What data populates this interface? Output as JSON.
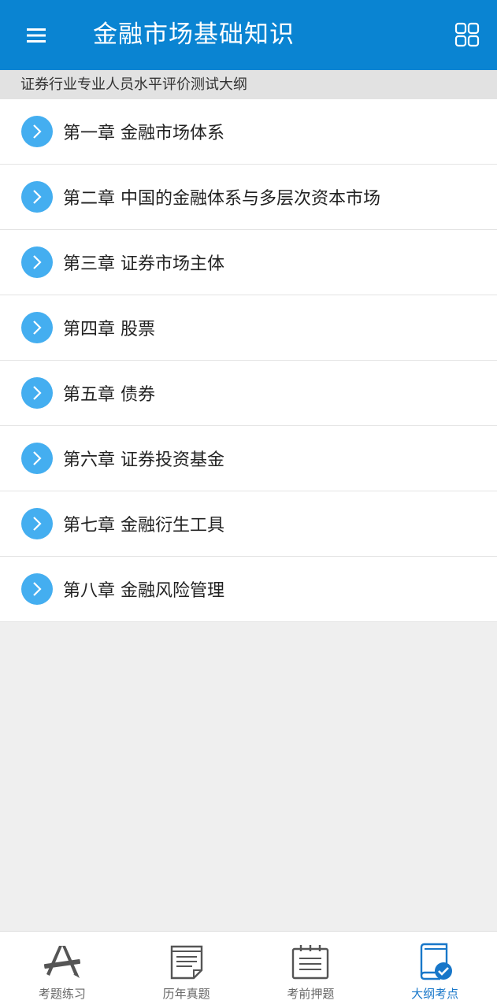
{
  "header": {
    "title": "金融市场基础知识",
    "menu_icon": "hamburger-icon",
    "grid_icon": "grid-icon"
  },
  "subheader": {
    "text": "证券行业专业人员水平评价测试大纲"
  },
  "chapters": [
    {
      "label": "第一章 金融市场体系"
    },
    {
      "label": "第二章 中国的金融体系与多层次资本市场"
    },
    {
      "label": "第三章 证券市场主体"
    },
    {
      "label": "第四章 股票"
    },
    {
      "label": "第五章 债券"
    },
    {
      "label": "第六章 证券投资基金"
    },
    {
      "label": "第七章 金融衍生工具"
    },
    {
      "label": "第八章 金融风险管理"
    }
  ],
  "tabs": [
    {
      "label": "考题练习",
      "icon": "pencil-ruler-icon",
      "active": false
    },
    {
      "label": "历年真题",
      "icon": "document-icon",
      "active": false
    },
    {
      "label": "考前押题",
      "icon": "notepad-icon",
      "active": false
    },
    {
      "label": "大纲考点",
      "icon": "book-check-icon",
      "active": true
    }
  ],
  "colors": {
    "header_bg": "#0a84d2",
    "accent": "#44aef0",
    "active_tab": "#1877c9"
  }
}
